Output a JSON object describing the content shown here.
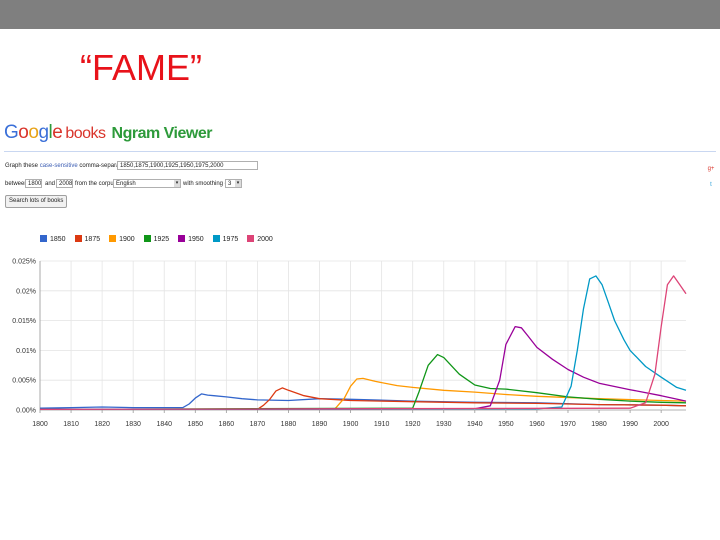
{
  "slide": {
    "title": "“FAME”"
  },
  "app": {
    "logo_letters": [
      "G",
      "o",
      "o",
      "g",
      "l",
      "e"
    ],
    "logo_books": "books",
    "logo_viewer": "Ngram Viewer"
  },
  "form": {
    "graph_these": "Graph these",
    "case_sensitive": "case-sensitive",
    "comma_text": "comma-separated phrases:",
    "phrases_value": "1850,1875,1900,1925,1950,1975,2000",
    "between": "between",
    "start_year": "1800",
    "and": "and",
    "end_year": "2008",
    "from_corpus": "from the corpus",
    "corpus_value": "English",
    "smoothing_text": "with smoothing of",
    "smoothing_value": "3",
    "search_button": "Search lots of books"
  },
  "colors": {
    "1850": "#3366cc",
    "1875": "#dc3912",
    "1900": "#ff9900",
    "1925": "#109618",
    "1950": "#990099",
    "1975": "#0099c6",
    "2000": "#dd4477"
  },
  "chart_data": {
    "type": "line",
    "xlim": [
      1800,
      2008
    ],
    "ylim": [
      0,
      0.025
    ],
    "yticks": [
      "0.025%",
      "0.02%",
      "0.015%",
      "0.01%",
      "0.005%",
      "0.00%"
    ],
    "ytick_values": [
      0.025,
      0.02,
      0.015,
      0.01,
      0.005,
      0
    ],
    "xticks": [
      "1800",
      "1810",
      "1820",
      "1830",
      "1840",
      "1850",
      "1860",
      "1870",
      "1880",
      "1890",
      "1900",
      "1910",
      "1920",
      "1930",
      "1940",
      "1950",
      "1960",
      "1970",
      "1980",
      "1990",
      "2000"
    ],
    "xtick_values": [
      1800,
      1810,
      1820,
      1830,
      1840,
      1850,
      1860,
      1870,
      1880,
      1890,
      1900,
      1910,
      1920,
      1930,
      1940,
      1950,
      1960,
      1970,
      1980,
      1990,
      2000
    ],
    "legend_position": "top-left",
    "grid": true,
    "series": [
      {
        "name": "1850",
        "color": "#3366cc",
        "x": [
          1800,
          1810,
          1820,
          1830,
          1840,
          1846,
          1848,
          1850,
          1852,
          1854,
          1856,
          1860,
          1865,
          1870,
          1880,
          1890,
          1900,
          1920,
          1940,
          1960,
          1980,
          2000,
          2008
        ],
        "y": [
          0.0003,
          0.0004,
          0.0005,
          0.0004,
          0.0004,
          0.0004,
          0.001,
          0.002,
          0.0027,
          0.0025,
          0.0024,
          0.0022,
          0.0019,
          0.0017,
          0.0016,
          0.0019,
          0.0018,
          0.0015,
          0.0013,
          0.0012,
          0.0009,
          0.0008,
          0.0007
        ]
      },
      {
        "name": "1875",
        "color": "#dc3912",
        "x": [
          1800,
          1870,
          1872,
          1874,
          1876,
          1878,
          1880,
          1885,
          1890,
          1900,
          1920,
          1940,
          1960,
          1980,
          2000,
          2008
        ],
        "y": [
          0.0001,
          0.0001,
          0.0008,
          0.0018,
          0.0032,
          0.0037,
          0.0033,
          0.0024,
          0.0019,
          0.0016,
          0.0014,
          0.0012,
          0.0011,
          0.0009,
          0.0008,
          0.0007
        ]
      },
      {
        "name": "1900",
        "color": "#ff9900",
        "x": [
          1800,
          1895,
          1898,
          1900,
          1902,
          1904,
          1908,
          1915,
          1920,
          1930,
          1940,
          1950,
          1960,
          1980,
          2000,
          2008
        ],
        "y": [
          0.0001,
          0.0002,
          0.002,
          0.004,
          0.0052,
          0.0053,
          0.0048,
          0.0041,
          0.0038,
          0.0033,
          0.003,
          0.0026,
          0.0023,
          0.0019,
          0.0016,
          0.0015
        ]
      },
      {
        "name": "1925",
        "color": "#109618",
        "x": [
          1800,
          1920,
          1922,
          1925,
          1928,
          1930,
          1935,
          1940,
          1945,
          1950,
          1960,
          1970,
          1980,
          1990,
          2000,
          2008
        ],
        "y": [
          0.0001,
          0.0003,
          0.003,
          0.0075,
          0.0093,
          0.0088,
          0.006,
          0.0042,
          0.0036,
          0.0035,
          0.0029,
          0.0022,
          0.0018,
          0.0015,
          0.0013,
          0.0012
        ]
      },
      {
        "name": "1950",
        "color": "#990099",
        "x": [
          1800,
          1940,
          1945,
          1948,
          1950,
          1953,
          1955,
          1957,
          1960,
          1965,
          1970,
          1975,
          1980,
          1990,
          2000,
          2008
        ],
        "y": [
          0.0001,
          0.0002,
          0.0007,
          0.005,
          0.011,
          0.014,
          0.0138,
          0.0125,
          0.0105,
          0.0085,
          0.0068,
          0.0055,
          0.0045,
          0.0034,
          0.0024,
          0.0015
        ]
      },
      {
        "name": "1975",
        "color": "#0099c6",
        "x": [
          1800,
          1960,
          1968,
          1971,
          1973,
          1975,
          1977,
          1979,
          1981,
          1983,
          1985,
          1988,
          1990,
          1995,
          2000,
          2005,
          2008
        ],
        "y": [
          0.0001,
          0.0002,
          0.0005,
          0.004,
          0.01,
          0.017,
          0.022,
          0.0225,
          0.021,
          0.018,
          0.015,
          0.0118,
          0.01,
          0.0073,
          0.0055,
          0.0038,
          0.0033
        ]
      },
      {
        "name": "2000",
        "color": "#dd4477",
        "x": [
          1800,
          1990,
          1995,
          1998,
          2000,
          2002,
          2004,
          2006,
          2008
        ],
        "y": [
          0.0001,
          0.0003,
          0.0012,
          0.006,
          0.014,
          0.021,
          0.0225,
          0.021,
          0.0195
        ]
      }
    ]
  }
}
